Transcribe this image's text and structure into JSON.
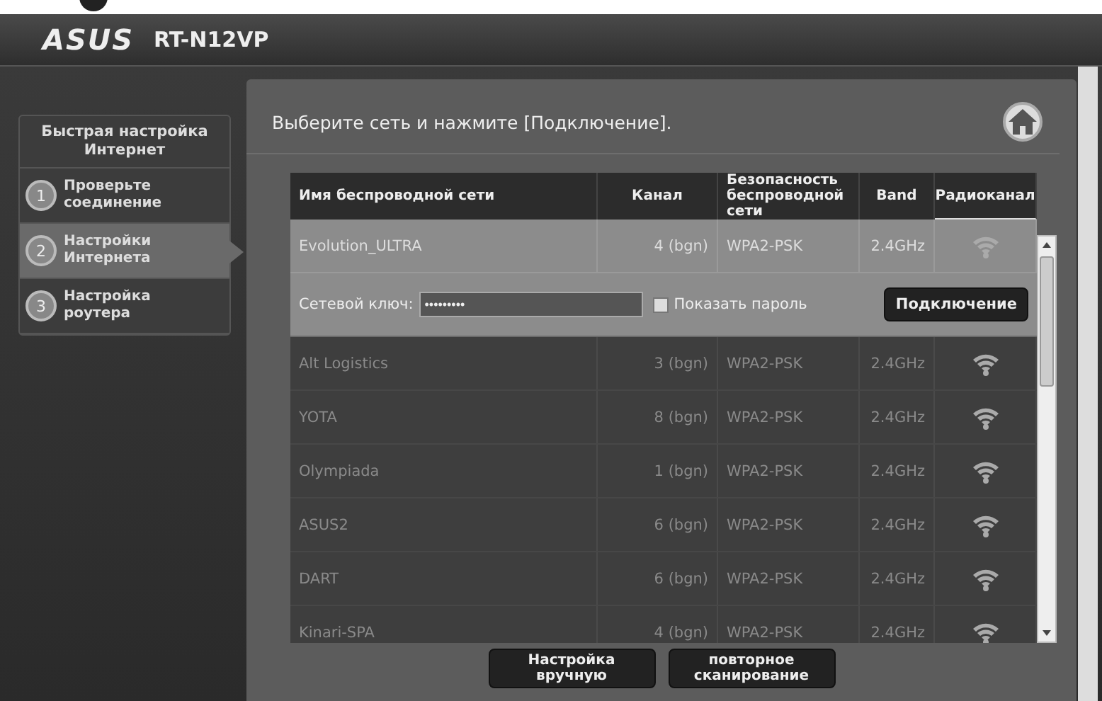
{
  "header": {
    "logo": "ASUS",
    "model": "RT-N12VP"
  },
  "sidebar": {
    "title": "Быстрая настройка Интернет",
    "items": [
      {
        "number": "1",
        "label": "Проверьте соединение",
        "selected": false
      },
      {
        "number": "2",
        "label": "Настройки Интернета",
        "selected": true
      },
      {
        "number": "3",
        "label": "Настройка роутера",
        "selected": false
      }
    ]
  },
  "main": {
    "instruction": "Выберите сеть и нажмите [Подключение].",
    "table": {
      "columns": [
        "Имя беспроводной сети",
        "Канал",
        "Безопасность беспроводной сети",
        "Band",
        "Радиоканал"
      ],
      "rows": [
        {
          "ssid": "Evolution_ULTRA",
          "channel": "4 (bgn)",
          "security": "WPA2-PSK",
          "band": "2.4GHz",
          "selected": true
        },
        {
          "ssid": "Alt Logistics",
          "channel": "3 (bgn)",
          "security": "WPA2-PSK",
          "band": "2.4GHz",
          "selected": false
        },
        {
          "ssid": "YOTA",
          "channel": "8 (bgn)",
          "security": "WPA2-PSK",
          "band": "2.4GHz",
          "selected": false
        },
        {
          "ssid": "Olympiada",
          "channel": "1 (bgn)",
          "security": "WPA2-PSK",
          "band": "2.4GHz",
          "selected": false
        },
        {
          "ssid": "ASUS2",
          "channel": "6 (bgn)",
          "security": "WPA2-PSK",
          "band": "2.4GHz",
          "selected": false
        },
        {
          "ssid": "DART",
          "channel": "6 (bgn)",
          "security": "WPA2-PSK",
          "band": "2.4GHz",
          "selected": false
        },
        {
          "ssid": "Kinari-SPA",
          "channel": "4 (bgn)",
          "security": "WPA2-PSK",
          "band": "2.4GHz",
          "selected": false
        }
      ],
      "connect_form": {
        "key_label": "Сетевой ключ:",
        "key_value": "•••••••••",
        "show_password_label": "Показать пароль",
        "show_password_checked": false,
        "connect_button": "Подключение"
      }
    },
    "buttons": [
      "Настройка вручную",
      "повторное сканирование"
    ]
  }
}
